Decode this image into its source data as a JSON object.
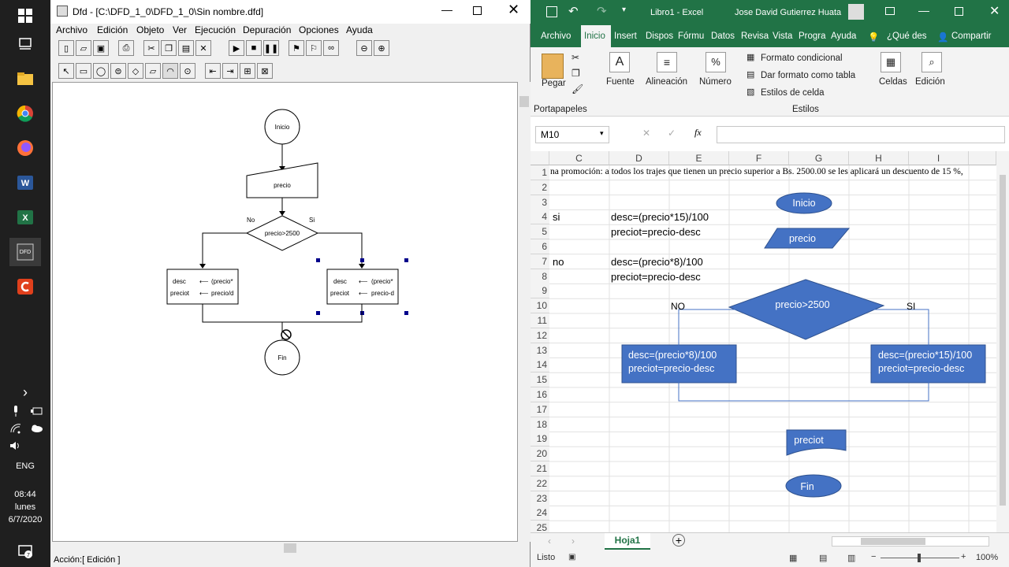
{
  "taskbar": {
    "lang": "ENG",
    "time": "08:44",
    "day": "lunes",
    "date": "6/7/2020",
    "notif_count": "7"
  },
  "dfd": {
    "title": "Dfd - [C:\\DFD_1_0\\DFD_1_0\\Sin nombre.dfd]",
    "menu": [
      "Archivo",
      "Edición",
      "Objeto",
      "Ver",
      "Ejecución",
      "Depuración",
      "Opciones",
      "Ayuda"
    ],
    "status": "Acción:[ Edición ]",
    "flow": {
      "start": "Inicio",
      "input": "precio",
      "cond": "precio>2500",
      "no": "No",
      "yes": "Si",
      "left_a1": "desc",
      "left_a1_val": "(precio*",
      "left_a2": "preciot",
      "left_a2_val": "precio/d",
      "right_a1": "desc",
      "right_a1_val": "(precio*",
      "right_a2": "preciot",
      "right_a2_val": "precio-d",
      "end": "Fin"
    }
  },
  "excel": {
    "book": "Libro1  -  Excel",
    "user": "Jose David Gutierrez Huata",
    "tabs": [
      "Archivo",
      "Inicio",
      "Insertar",
      "Disposición",
      "Fórmulas",
      "Datos",
      "Revisar",
      "Vista",
      "Programador",
      "Ayuda"
    ],
    "tab_labels": [
      "Archivo",
      "Inicio",
      "Insert",
      "Dispos",
      "Fórmu",
      "Datos",
      "Revisa",
      "Vista",
      "Progra",
      "Ayuda"
    ],
    "tell_me": "¿Qué des",
    "share": "Compartir",
    "ribbon": {
      "paste": "Pegar",
      "clipboard": "Portapapeles",
      "font": "Fuente",
      "align": "Alineación",
      "number": "Número",
      "cond_format": "Formato condicional",
      "table_format": "Dar formato como tabla",
      "cell_styles": "Estilos de celda",
      "styles": "Estilos",
      "cells": "Celdas",
      "editing": "Edición"
    },
    "name_box": "M10",
    "columns": [
      "C",
      "D",
      "E",
      "F",
      "G",
      "H",
      "I"
    ],
    "rows": [
      "1",
      "2",
      "3",
      "4",
      "5",
      "6",
      "7",
      "8",
      "9",
      "10",
      "11",
      "12",
      "13",
      "14",
      "15",
      "16",
      "17",
      "18",
      "19",
      "20",
      "21",
      "22",
      "23",
      "24",
      "25"
    ],
    "cells": {
      "r1": "na promoción: a todos los trajes que tienen un precio superior a Bs. 2500.00 se les aplicará un descuento de 15 %,",
      "c4": "si",
      "d4": "desc=(precio*15)/100",
      "d5": "preciot=precio-desc",
      "c7": "no",
      "d7": "desc=(precio*8)/100",
      "d8": "preciot=precio-desc"
    },
    "shapes": {
      "start": "Inicio",
      "input": "precio",
      "cond": "precio>2500",
      "no": "NO",
      "yes": "SI",
      "left_box_1": "desc=(precio*8)/100",
      "left_box_2": "preciot=precio-desc",
      "right_box_1": "desc=(precio*15)/100",
      "right_box_2": "preciot=precio-desc",
      "output": "preciot",
      "end": "Fin"
    },
    "sheet_tab": "Hoja1",
    "status": "Listo",
    "zoom": "100%",
    "shape_color": "#4472c4"
  }
}
